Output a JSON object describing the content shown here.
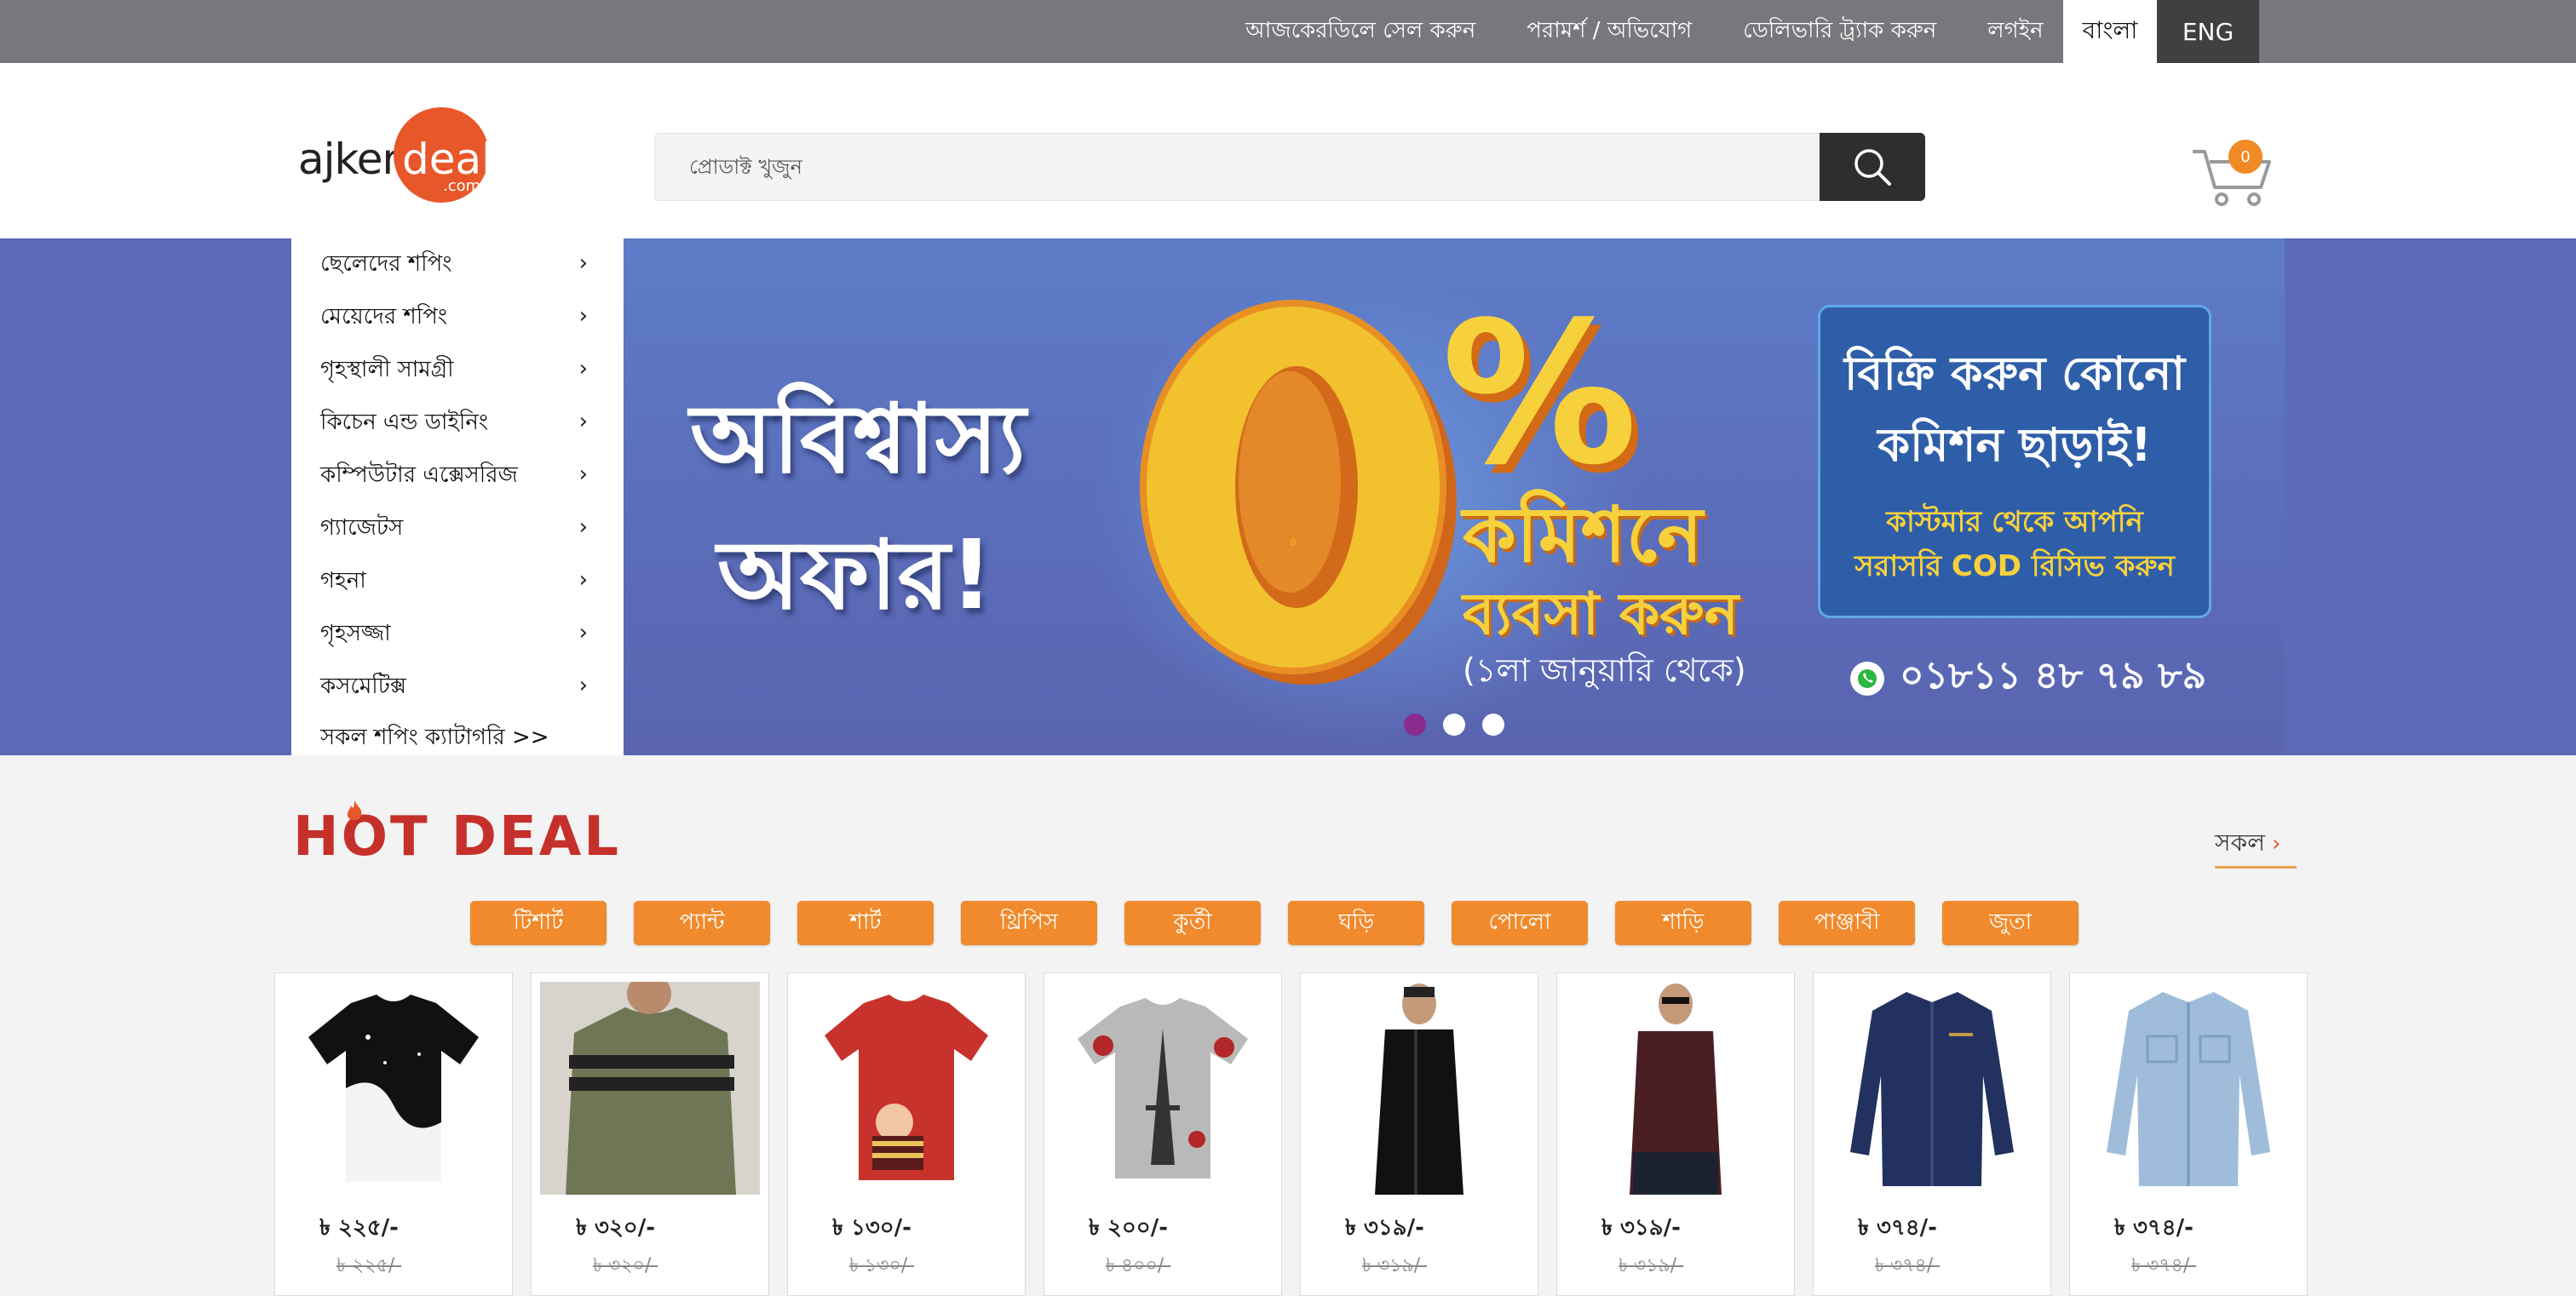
{
  "topbar": {
    "links": [
      "আজকেরডিলে সেল করুন",
      "পরামর্শ / অভিযোগ",
      "ডেলিভারি ট্র্যাক করুন",
      "লগইন"
    ],
    "lang_bn": "বাংলা",
    "lang_en": "ENG"
  },
  "header": {
    "logo_part1": "ajker",
    "logo_part2": "deal",
    "logo_part3": ".com",
    "search_placeholder": "প্রোডাক্ট খুজুন",
    "cart_count": "0"
  },
  "categories": [
    "ছেলেদের শপিং",
    "মেয়েদের শপিং",
    "গৃহস্থালী সামগ্রী",
    "কিচেন এন্ড ডাইনিং",
    "কম্পিউটার এক্সেসরিজ",
    "গ্যাজেটস",
    "গহনা",
    "গৃহসজ্জা",
    "কসমেটিক্স",
    "সকল শপিং ক্যাটাগরি >>"
  ],
  "banner": {
    "headline1": "অবিশ্বাস্য",
    "headline2": "অফার!",
    "zero": "0",
    "percent": "%",
    "commission": "কমিশনে",
    "business": "ব্যবসা করুন",
    "date": "(১লা জানুয়ারি থেকে)",
    "box_line1": "বিক্রি করুন কোনো",
    "box_line2": "কমিশন ছাড়াই!",
    "box_line3": "কাস্টমার থেকে আপনি",
    "box_line4": "সরাসরি COD রিসিভ করুন",
    "phone": "০১৮১১ ৪৮ ৭৯ ৮৯",
    "slides": 3,
    "active_slide": 1
  },
  "hot_deal": {
    "title": "HOT DEAL",
    "see_all": "সকল",
    "filters": [
      "টিশার্ট",
      "প্যান্ট",
      "শার্ট",
      "থ্রিপিস",
      "কুর্তী",
      "ঘড়ি",
      "পোলো",
      "শাড়ি",
      "পাঞ্জাবী",
      "জুতা"
    ],
    "products": [
      {
        "price": "৳ ২২৫/-",
        "old_price": "৳ ২২৫/-"
      },
      {
        "price": "৳ ৩২০/-",
        "old_price": "৳ ৩২০/-"
      },
      {
        "price": "৳ ১৩০/-",
        "old_price": "৳ ১৩০/-"
      },
      {
        "price": "৳ ২০০/-",
        "old_price": "৳ ৪০০/-"
      },
      {
        "price": "৳ ৩১৯/-",
        "old_price": "৳ ৩১৯/-"
      },
      {
        "price": "৳ ৩১৯/-",
        "old_price": "৳ ৩১৯/-"
      },
      {
        "price": "৳ ৩৭৪/-",
        "old_price": "৳ ৩৭৪/-"
      },
      {
        "price": "৳ ৩৭৪/-",
        "old_price": "৳ ৩৭৪/-"
      }
    ]
  },
  "colors": {
    "topbar": "#77787c",
    "accent_orange": "#f08a2c",
    "hot_red": "#c6302b",
    "banner_blue": "#5b6bb8",
    "logo_orange": "#e8572a"
  }
}
